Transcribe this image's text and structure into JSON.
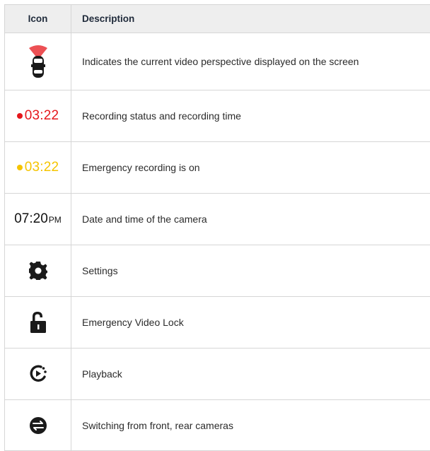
{
  "header": {
    "icon": "Icon",
    "description": "Description"
  },
  "colors": {
    "red": "#e5161b",
    "yellow": "#f5c400",
    "text": "#2b2b2b",
    "icon": "#1a1a1a"
  },
  "rows": [
    {
      "icon_name": "car-camera-view-icon",
      "description": "Indicates the current video perspective displayed on the screen"
    },
    {
      "icon_name": "recording-dot-icon",
      "icon_text": "03:22",
      "description": "Recording status and recording time"
    },
    {
      "icon_name": "emergency-recording-dot-icon",
      "icon_text": "03:22",
      "description": "Emergency recording is on"
    },
    {
      "icon_name": "clock-text",
      "icon_text": "07:20",
      "icon_suffix": "PM",
      "description": "Date and time of the camera"
    },
    {
      "icon_name": "gear-icon",
      "description": "Settings"
    },
    {
      "icon_name": "unlock-icon",
      "description": "Emergency Video Lock"
    },
    {
      "icon_name": "playback-icon",
      "description": "Playback"
    },
    {
      "icon_name": "switch-camera-icon",
      "description": "Switching from front, rear cameras"
    }
  ]
}
